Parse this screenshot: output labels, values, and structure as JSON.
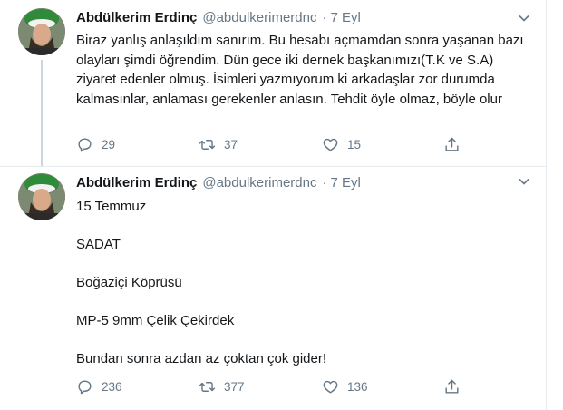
{
  "tweets": [
    {
      "author_name": "Abdülkerim Erdinç",
      "handle": "@abdulkerimerdnc",
      "separator": "·",
      "date": "7 Eyl",
      "text": "Biraz yanlış anlaşıldım sanırım. Bu hesabı açmamdan sonra yaşanan bazı olayları şimdi öğrendim. Dün gece iki dernek başkanımızı(T.K ve S.A) ziyaret edenler olmuş. İsimleri yazmıyorum ki arkadaşlar zor durumda kalmasınlar, anlaması gerekenler anlasın. Tehdit öyle olmaz, böyle olur",
      "replies": "29",
      "retweets": "37",
      "likes": "15"
    },
    {
      "author_name": "Abdülkerim Erdinç",
      "handle": "@abdulkerimerdnc",
      "separator": "·",
      "date": "7 Eyl",
      "lines": [
        "15 Temmuz",
        "SADAT",
        "Boğaziçi Köprüsü",
        "MP-5 9mm Çelik Çekirdek",
        "Bundan sonra azdan az çoktan çok gider!"
      ],
      "replies": "236",
      "retweets": "377",
      "likes": "136"
    }
  ],
  "icons": {
    "reply": "reply-icon",
    "retweet": "retweet-icon",
    "like": "like-icon",
    "share": "share-icon",
    "menu": "chevron-down-icon"
  },
  "colors": {
    "text": "#14171a",
    "muted": "#657786",
    "divider": "#e6ecf0",
    "thread_line": "#ccd6dd"
  }
}
